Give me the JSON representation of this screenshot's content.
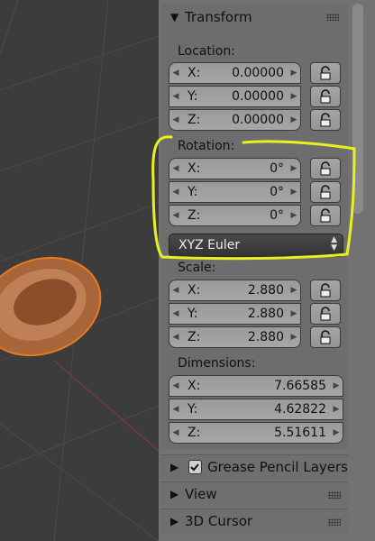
{
  "transform": {
    "title": "Transform",
    "location": {
      "label": "Location:",
      "x": "0.00000",
      "y": "0.00000",
      "z": "0.00000"
    },
    "rotation": {
      "label": "Rotation:",
      "x": "0°",
      "y": "0°",
      "z": "0°",
      "mode": "XYZ Euler"
    },
    "scale": {
      "label": "Scale:",
      "x": "2.880",
      "y": "2.880",
      "z": "2.880"
    },
    "dimensions": {
      "label": "Dimensions:",
      "x": "7.66585",
      "y": "4.62822",
      "z": "5.51611"
    },
    "axis_labels": {
      "x": "X:",
      "y": "Y:",
      "z": "Z:"
    }
  },
  "panels": {
    "grease_pencil": "Grease Pencil Layers",
    "view": "View",
    "cursor_3d": "3D Cursor"
  },
  "colors": {
    "highlight": "#e8f020",
    "object": "#a8653a",
    "selection_outline": "#e87a1e",
    "panel_bg": "#727272"
  }
}
